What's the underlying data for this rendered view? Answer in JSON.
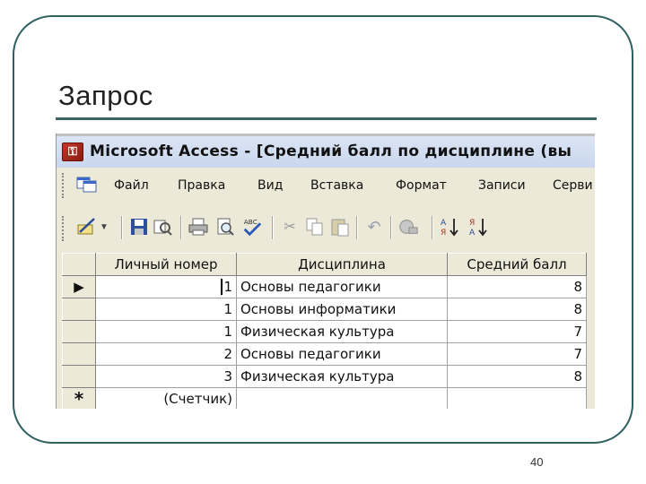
{
  "slide": {
    "title": "Запрос",
    "page_number": "40"
  },
  "window": {
    "title": "Microsoft Access - [Средний балл по дисциплине (вы",
    "icon_glyph": "🔑"
  },
  "menu": {
    "items": [
      "Файл",
      "Правка",
      "Вид",
      "Вставка",
      "Формат",
      "Записи",
      "Серви"
    ]
  },
  "toolbar": {
    "icons": [
      "design-view-icon",
      "dropdown-arrow-icon",
      "save-icon",
      "search-icon",
      "print-icon",
      "print-preview-icon",
      "spelling-icon",
      "cut-icon",
      "copy-icon",
      "paste-icon",
      "undo-icon",
      "web-icon",
      "sort-ascending-icon",
      "sort-descending-icon"
    ]
  },
  "table": {
    "headers": [
      "Личный номер",
      "Дисциплина",
      "Средний балл"
    ],
    "current_row_marker": "▶",
    "new_row_marker": "*",
    "rows": [
      {
        "id": "1",
        "discipline": "Основы педагогики",
        "score": "8"
      },
      {
        "id": "1",
        "discipline": "Основы информатики",
        "score": "8"
      },
      {
        "id": "1",
        "discipline": "Физическая культура",
        "score": "7"
      },
      {
        "id": "2",
        "discipline": "Основы педагогики",
        "score": "7"
      },
      {
        "id": "3",
        "discipline": "Физическая культура",
        "score": "8"
      }
    ],
    "new_row_placeholder": "(Счетчик)"
  }
}
